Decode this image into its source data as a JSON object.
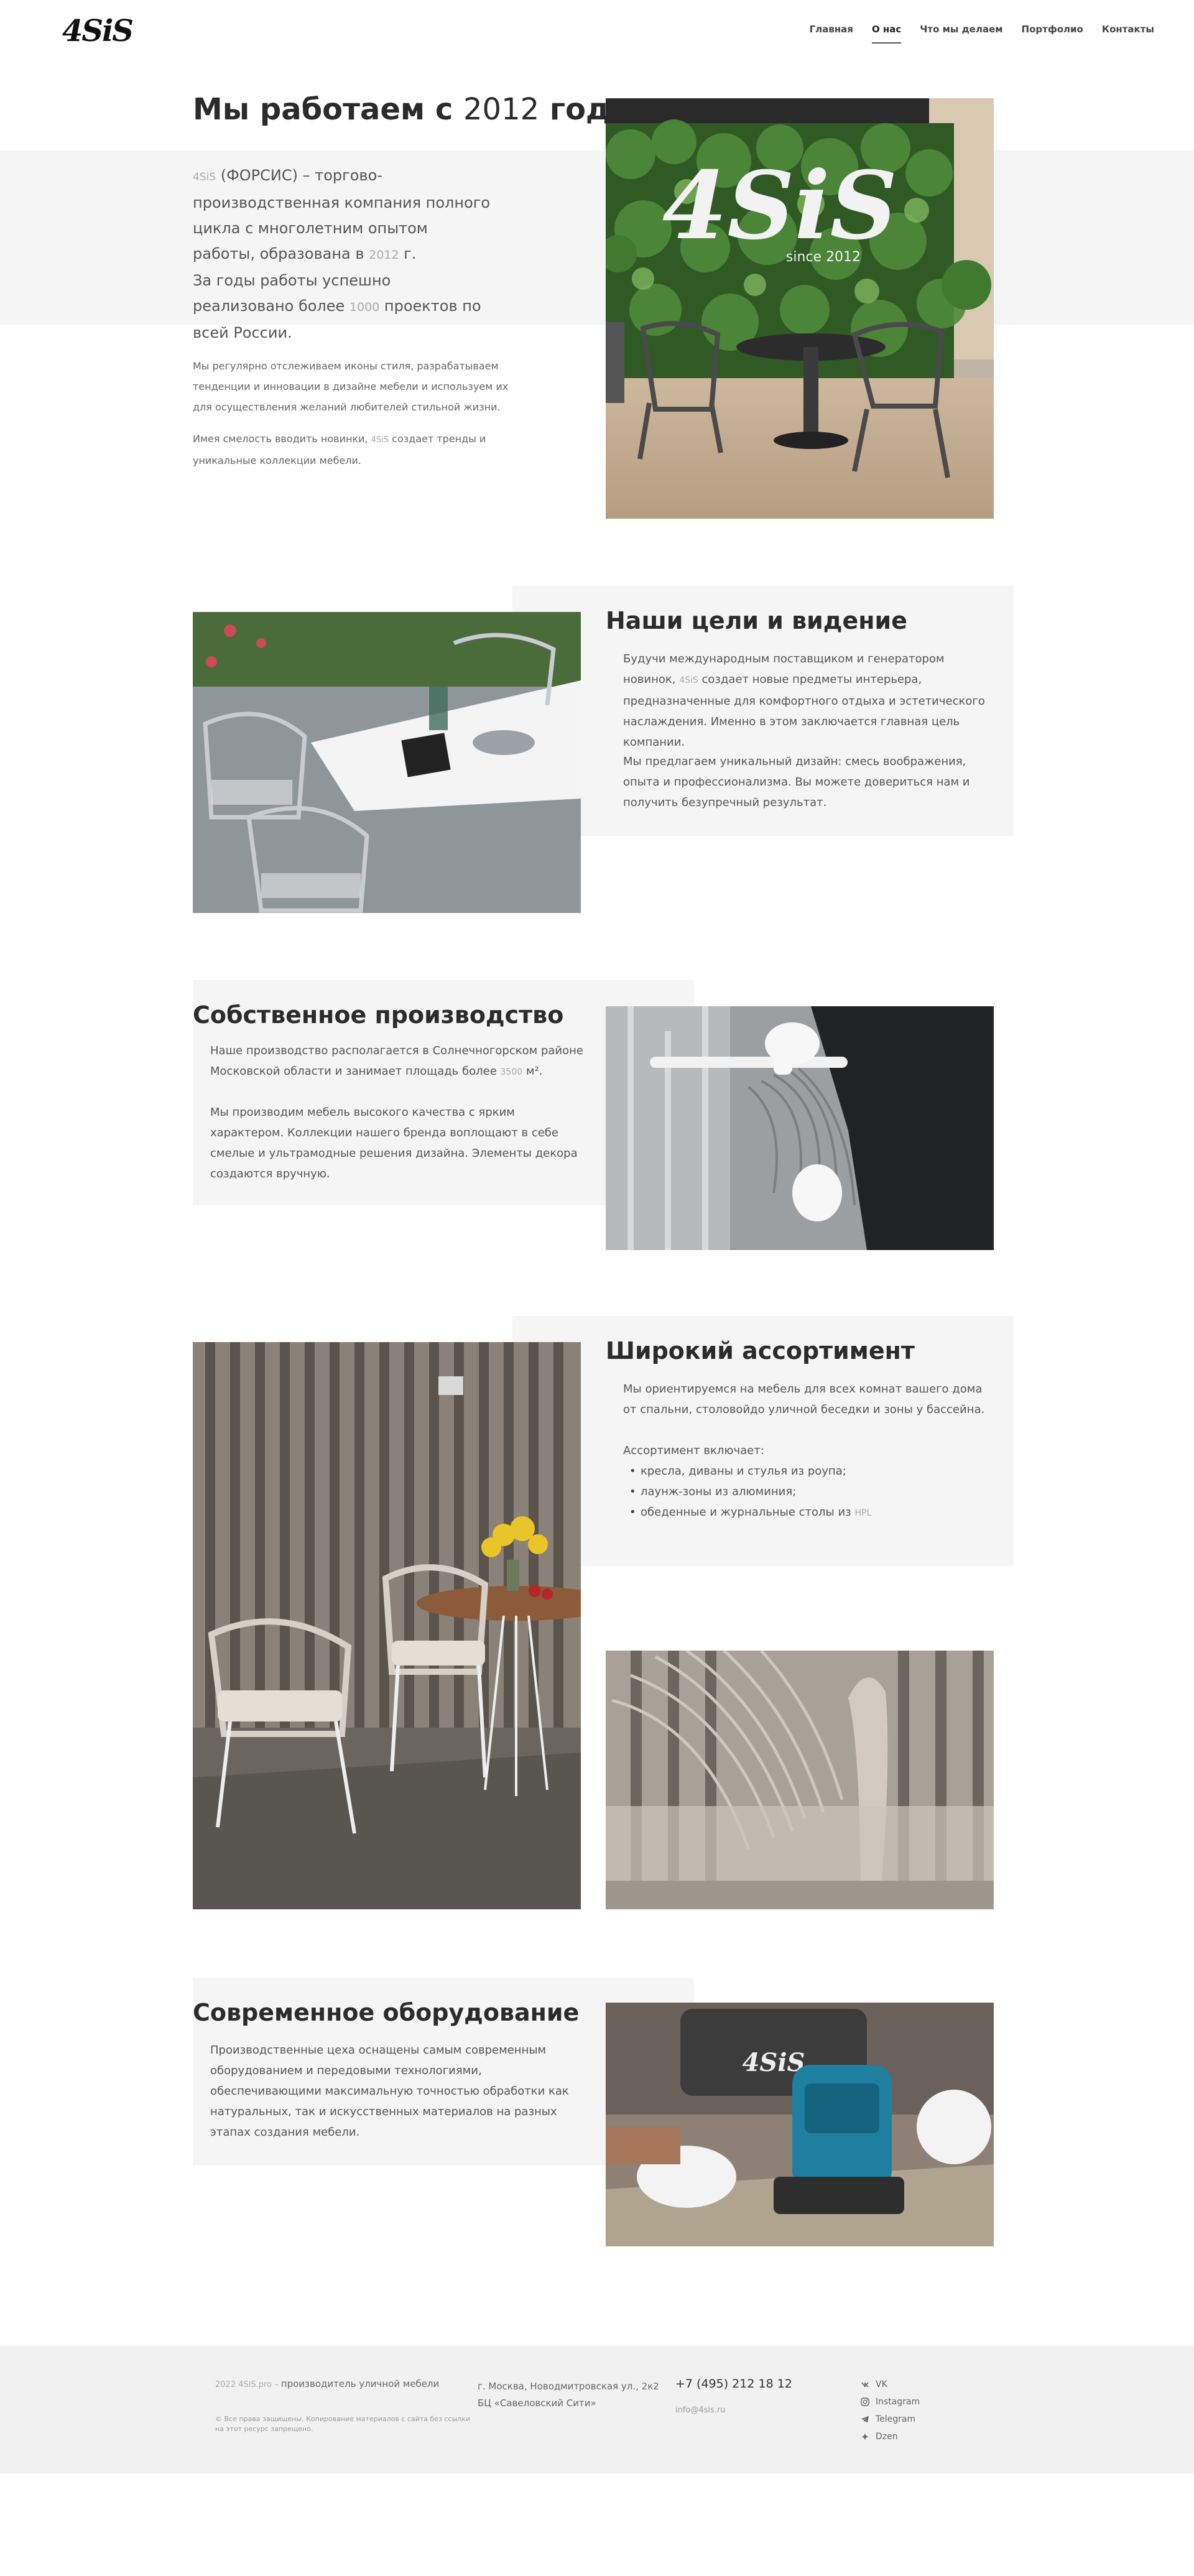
{
  "brand": {
    "logo": "4SiS"
  },
  "nav": [
    {
      "label": "Главная",
      "active": false
    },
    {
      "label": "О нас",
      "active": true
    },
    {
      "label": "Что мы делаем",
      "active": false
    },
    {
      "label": "Портфолио",
      "active": false
    },
    {
      "label": "Контакты",
      "active": false
    }
  ],
  "intro": {
    "title_a": "Мы работаем с ",
    "title_year": "2012",
    "title_b": " года",
    "lead_1a": "4SiS",
    "lead_1b": " (ФОРСИС) – торгово-производственная компания полного цикла с многолетним опытом работы, образована в ",
    "lead_year": "2012",
    "lead_1c": " г.",
    "lead_2a": "За годы работы успешно реализовано более ",
    "lead_num": "1000",
    "lead_2b": " проектов по всей России.",
    "para_1": "Мы регулярно отслеживаем иконы стиля, разрабатываем тенденции и инновации в дизайне мебели и используем их для осуществления желаний любителей стильной жизни.",
    "para_2a": "Имея смелость вводить новинки, ",
    "para_2_brand": "4SiS",
    "para_2b": " создает тренды и уникальные коллекции мебели.",
    "wall_text": "4SiS",
    "wall_since": "since 2012"
  },
  "goals": {
    "title": "Наши цели и видение",
    "p1a": "Будучи международным поставщиком и генератором новинок, ",
    "p1_brand": "4SiS",
    "p1b": " создает новые предметы интерьера, предназначенные для комфортного отдыха и эстетического наслаждения. Именно в этом заключается главная цель компании.",
    "p2": "Мы предлагаем уникальный дизайн: смесь воображения, опыта и профессионализма. Вы можете довериться нам и получить безупречный результат."
  },
  "production": {
    "title": "Собственное производство",
    "p1a": "Наше производство располагается в Солнечногорском районе Московской области и занимает площадь более ",
    "p1_num": "3500",
    "p1b": " м².",
    "p2": "Мы производим мебель высокого качества с ярким характером. Коллекции нашего бренда воплощают в себе смелые и ультрамодные решения дизайна. Элементы декора создаются вручную."
  },
  "assortment": {
    "title": "Широкий ассортимент",
    "p1": "Мы ориентируемся на мебель для всех комнат вашего дома от спальни, столовойдо уличной беседки и зоны у бассейна.",
    "includes": "Ассортимент включает:",
    "items": [
      "кресла, диваны и стулья из роупа;",
      "лаунж-зоны из алюминия;",
      "обеденные и журнальные столы из "
    ],
    "item3_tail": "HPL"
  },
  "equipment": {
    "title": "Современное оборудование",
    "p1": "Производственные цеха оснащены самым современным оборудованием и передовыми технологиями, обеспечивающими максимальную точностью обработки как натуральных, так и искусственных материалов на разных этапах создания мебели."
  },
  "footer": {
    "copy_light": "2022 4SiS.pro – ",
    "copy_main": "производитель уличной мебели",
    "rights": "© Все права защищены. Копирование материалов с сайта без ссылки на этот ресурс запрещено.",
    "address": "г. Москва, Новодмитровская ул., 2к2 БЦ «Савеловский Сити»",
    "phone": "+7 (495) 212 18 12",
    "email": "info@4sis.ru",
    "social": [
      {
        "label": "VK",
        "icon": "vk-icon"
      },
      {
        "label": "Instagram",
        "icon": "instagram-icon"
      },
      {
        "label": "Telegram",
        "icon": "telegram-icon"
      },
      {
        "label": "Dzen",
        "icon": "dzen-icon"
      }
    ]
  }
}
